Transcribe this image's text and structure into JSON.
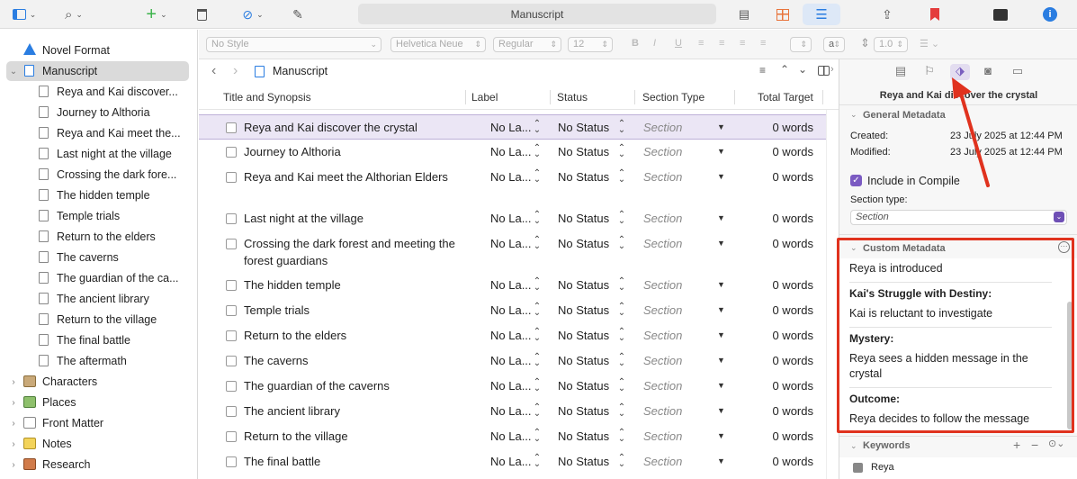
{
  "toolbar": {
    "title": "Manuscript",
    "icons": [
      "sidebar-icon",
      "search-icon",
      "add-icon",
      "trash-icon",
      "paperclip-icon",
      "compose-icon",
      "corkboard-icon",
      "grid-icon",
      "outline-icon",
      "share-icon",
      "bookmark-icon",
      "composition-icon",
      "info-icon"
    ]
  },
  "format_bar": {
    "style": "No Style",
    "font": "Helvetica Neue",
    "weight": "Regular",
    "size": "12",
    "bold": "B",
    "italic": "I",
    "underline": "U",
    "text_color": "a",
    "line_spacing": "1.0"
  },
  "binder": {
    "novel_format": "Novel Format",
    "manuscript": "Manuscript",
    "docs": [
      "Reya and Kai discover...",
      "Journey to Althoria",
      "Reya and Kai meet the...",
      "Last night at the village",
      "Crossing the dark fore...",
      "The hidden temple",
      "Temple trials",
      "Return to the elders",
      "The caverns",
      "The guardian of the ca...",
      "The ancient library",
      "Return to the village",
      "The final battle",
      "The aftermath"
    ],
    "folders": [
      "Characters",
      "Places",
      "Front Matter",
      "Notes",
      "Research"
    ]
  },
  "editor": {
    "header": "Manuscript",
    "columns": {
      "title": "Title and Synopsis",
      "label": "Label",
      "status": "Status",
      "section_type": "Section Type",
      "total_target": "Total Target"
    },
    "rows": [
      {
        "title": "Reya and Kai discover the crystal",
        "label": "No La...",
        "status": "No Status",
        "section": "Section",
        "words": "0 words"
      },
      {
        "title": "Journey to Althoria",
        "label": "No La...",
        "status": "No Status",
        "section": "Section",
        "words": "0 words"
      },
      {
        "title": "Reya and Kai meet the Althorian Elders",
        "label": "No La...",
        "status": "No Status",
        "section": "Section",
        "words": "0 words"
      },
      {
        "title": "Last night at the village",
        "label": "No La...",
        "status": "No Status",
        "section": "Section",
        "words": "0 words"
      },
      {
        "title": "Crossing the dark forest and meeting the forest guardians",
        "label": "No La...",
        "status": "No Status",
        "section": "Section",
        "words": "0 words"
      },
      {
        "title": "The hidden temple",
        "label": "No La...",
        "status": "No Status",
        "section": "Section",
        "words": "0 words"
      },
      {
        "title": "Temple trials",
        "label": "No La...",
        "status": "No Status",
        "section": "Section",
        "words": "0 words"
      },
      {
        "title": "Return to the elders",
        "label": "No La...",
        "status": "No Status",
        "section": "Section",
        "words": "0 words"
      },
      {
        "title": "The caverns",
        "label": "No La...",
        "status": "No Status",
        "section": "Section",
        "words": "0 words"
      },
      {
        "title": "The guardian of the caverns",
        "label": "No La...",
        "status": "No Status",
        "section": "Section",
        "words": "0 words"
      },
      {
        "title": "The ancient library",
        "label": "No La...",
        "status": "No Status",
        "section": "Section",
        "words": "0 words"
      },
      {
        "title": "Return to the village",
        "label": "No La...",
        "status": "No Status",
        "section": "Section",
        "words": "0 words"
      },
      {
        "title": "The final battle",
        "label": "No La...",
        "status": "No Status",
        "section": "Section",
        "words": "0 words"
      }
    ]
  },
  "inspector": {
    "doc_title": "Reya and Kai discover the crystal",
    "general_metadata": "General Metadata",
    "created_label": "Created:",
    "created_value": "23 July 2025 at 12:44 PM",
    "modified_label": "Modified:",
    "modified_value": "23 July 2025 at 12:44 PM",
    "include_in_compile": "Include in Compile",
    "section_type_label": "Section type:",
    "section_type_value": "Section",
    "custom_metadata": "Custom Metadata",
    "custom_fields": [
      {
        "name": "",
        "value": "Reya is introduced"
      },
      {
        "name": "Kai's Struggle with Destiny:",
        "value": "Kai is reluctant to investigate"
      },
      {
        "name": "Mystery:",
        "value": "Reya sees a hidden message in the crystal"
      },
      {
        "name": "Outcome:",
        "value": "Reya decides to follow the message"
      }
    ],
    "keywords": "Keywords",
    "keyword_items": [
      "Reya"
    ]
  },
  "colors": {
    "accent": "#7b5bc2",
    "highlight": "#e0321e",
    "selection": "#ebe6f5"
  }
}
